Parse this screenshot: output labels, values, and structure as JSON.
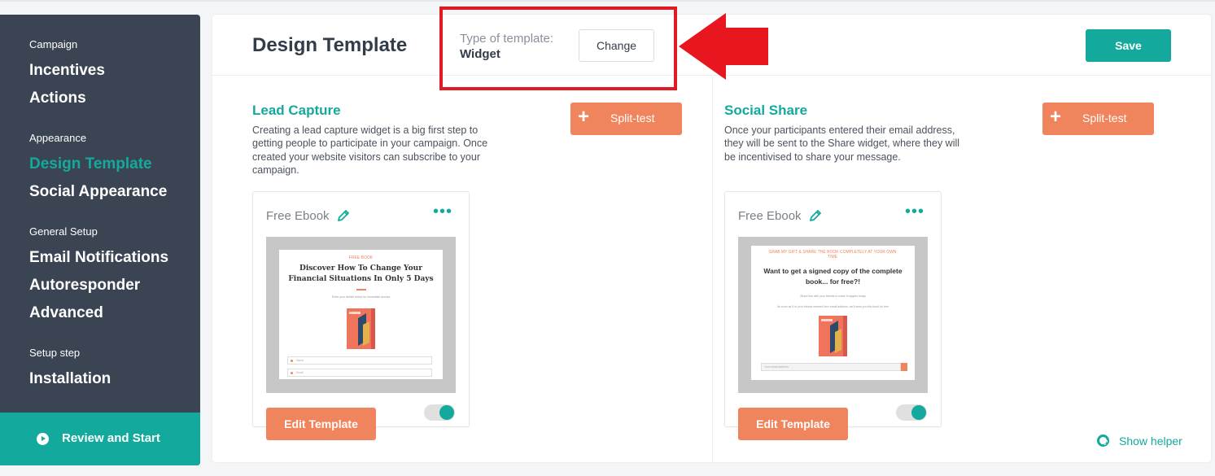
{
  "sidebar": {
    "groups": [
      {
        "label": "Campaign",
        "items": [
          {
            "label": "Incentives"
          },
          {
            "label": "Actions"
          }
        ]
      },
      {
        "label": "Appearance",
        "items": [
          {
            "label": "Design Template",
            "active": true
          },
          {
            "label": "Social Appearance"
          }
        ]
      },
      {
        "label": "General Setup",
        "items": [
          {
            "label": "Email Notifications"
          },
          {
            "label": "Autoresponder"
          },
          {
            "label": "Advanced"
          }
        ]
      },
      {
        "label": "Setup step",
        "items": [
          {
            "label": "Installation"
          }
        ]
      }
    ],
    "review_button": "Review and Start"
  },
  "header": {
    "title": "Design Template",
    "type_label": "Type of template:",
    "type_value": "Widget",
    "change_button": "Change",
    "save_button": "Save"
  },
  "sections": [
    {
      "title": "Lead Capture",
      "description": "Creating a lead capture widget is a big first step to getting people to participate in your campaign. Once created your website visitors can subscribe to your campaign.",
      "split_test_label": "Split-test",
      "card": {
        "name": "Free Ebook",
        "toggle_on": true,
        "preview": {
          "kicker": "FREE BOOK",
          "heading": "Discover How To Change Your Financial Situations In Only 5 Days",
          "subtext": "Enter your details below for immediate access",
          "fields": [
            "Name",
            "Email"
          ]
        },
        "edit_button": "Edit Template"
      }
    },
    {
      "title": "Social Share",
      "description": "Once your participants entered their email address, they will be sent to the Share widget, where they will be incentivised to share your message.",
      "split_test_label": "Split-test",
      "card": {
        "name": "Free Ebook",
        "toggle_on": true,
        "preview": {
          "kicker": "GRAB MY GIFT & SHARE THE BOOK COMPLETELY AT YOUR OWN TIME",
          "heading": "Want to get a signed copy of the complete book... for free?!",
          "subtext": "Share this with your friends to make it happen today",
          "subtext2": "As soon as 5 of your friends entered their email address, we'll send you the book for free",
          "fields": [
            "Your email address"
          ]
        },
        "edit_button": "Edit Template"
      }
    }
  ],
  "helper": {
    "label": "Show helper"
  },
  "colors": {
    "accent": "#13aa9d",
    "orange": "#f0845c",
    "sidebar": "#3a4452",
    "highlight": "#e01b24"
  }
}
